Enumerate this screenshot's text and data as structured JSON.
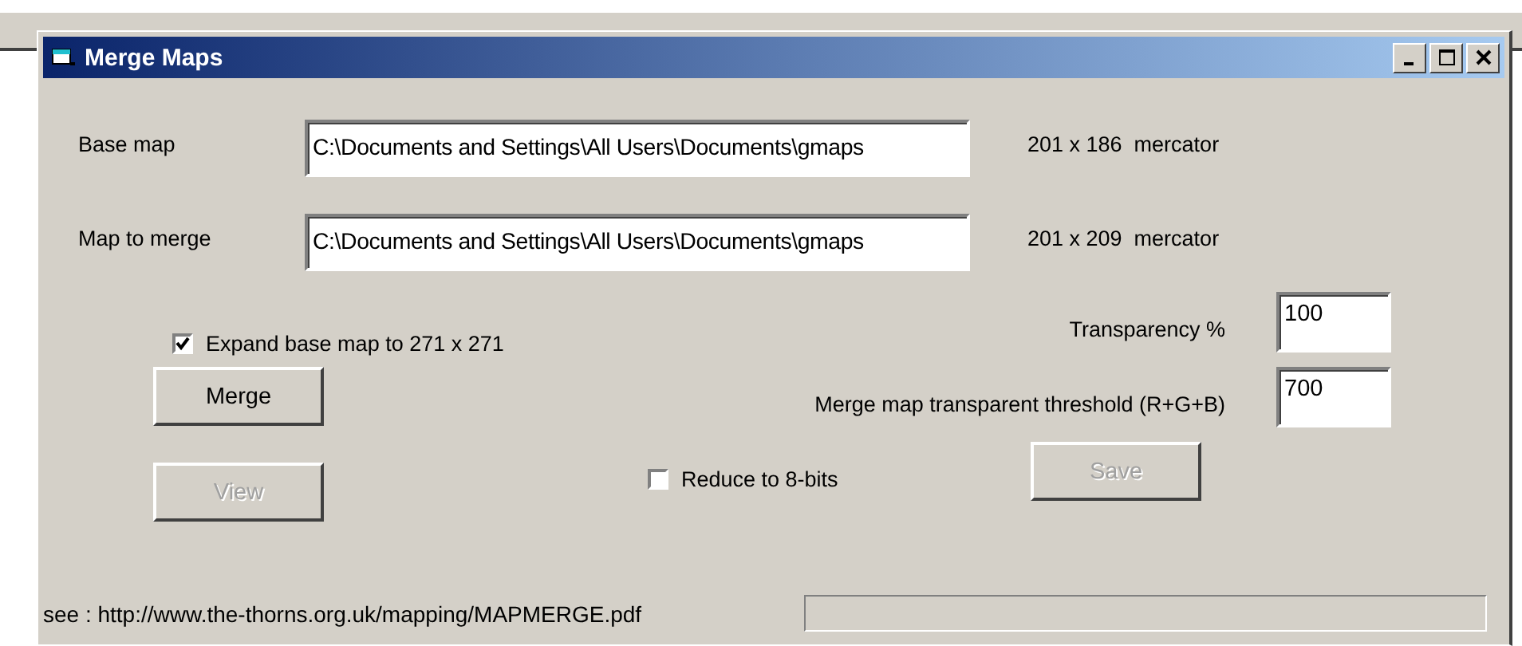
{
  "window": {
    "title": "Merge Maps"
  },
  "fields": [
    {
      "label": "Base map",
      "value": "C:\\Documents and Settings\\All Users\\Documents\\gmaps",
      "info": "201 x 186  mercator"
    },
    {
      "label": "Map to merge",
      "value": "C:\\Documents and Settings\\All Users\\Documents\\gmaps",
      "info": "201 x 209  mercator"
    }
  ],
  "expand_checkbox": {
    "label": "Expand base map to 271 x 271",
    "checked": true
  },
  "transparency": {
    "label": "Transparency %",
    "value": "100"
  },
  "threshold": {
    "label": "Merge map transparent threshold (R+G+B)",
    "value": "700"
  },
  "merge_button": {
    "label": "Merge",
    "disabled": false
  },
  "view_button": {
    "label": "View",
    "disabled": true
  },
  "reduce_checkbox": {
    "label": "Reduce to 8-bits",
    "checked": false
  },
  "save_button": {
    "label": "Save",
    "disabled": true
  },
  "footer": {
    "link": "see : http://www.the-thorns.org.uk/mapping/MAPMERGE.pdf",
    "progress": {
      "level": 0
    }
  }
}
